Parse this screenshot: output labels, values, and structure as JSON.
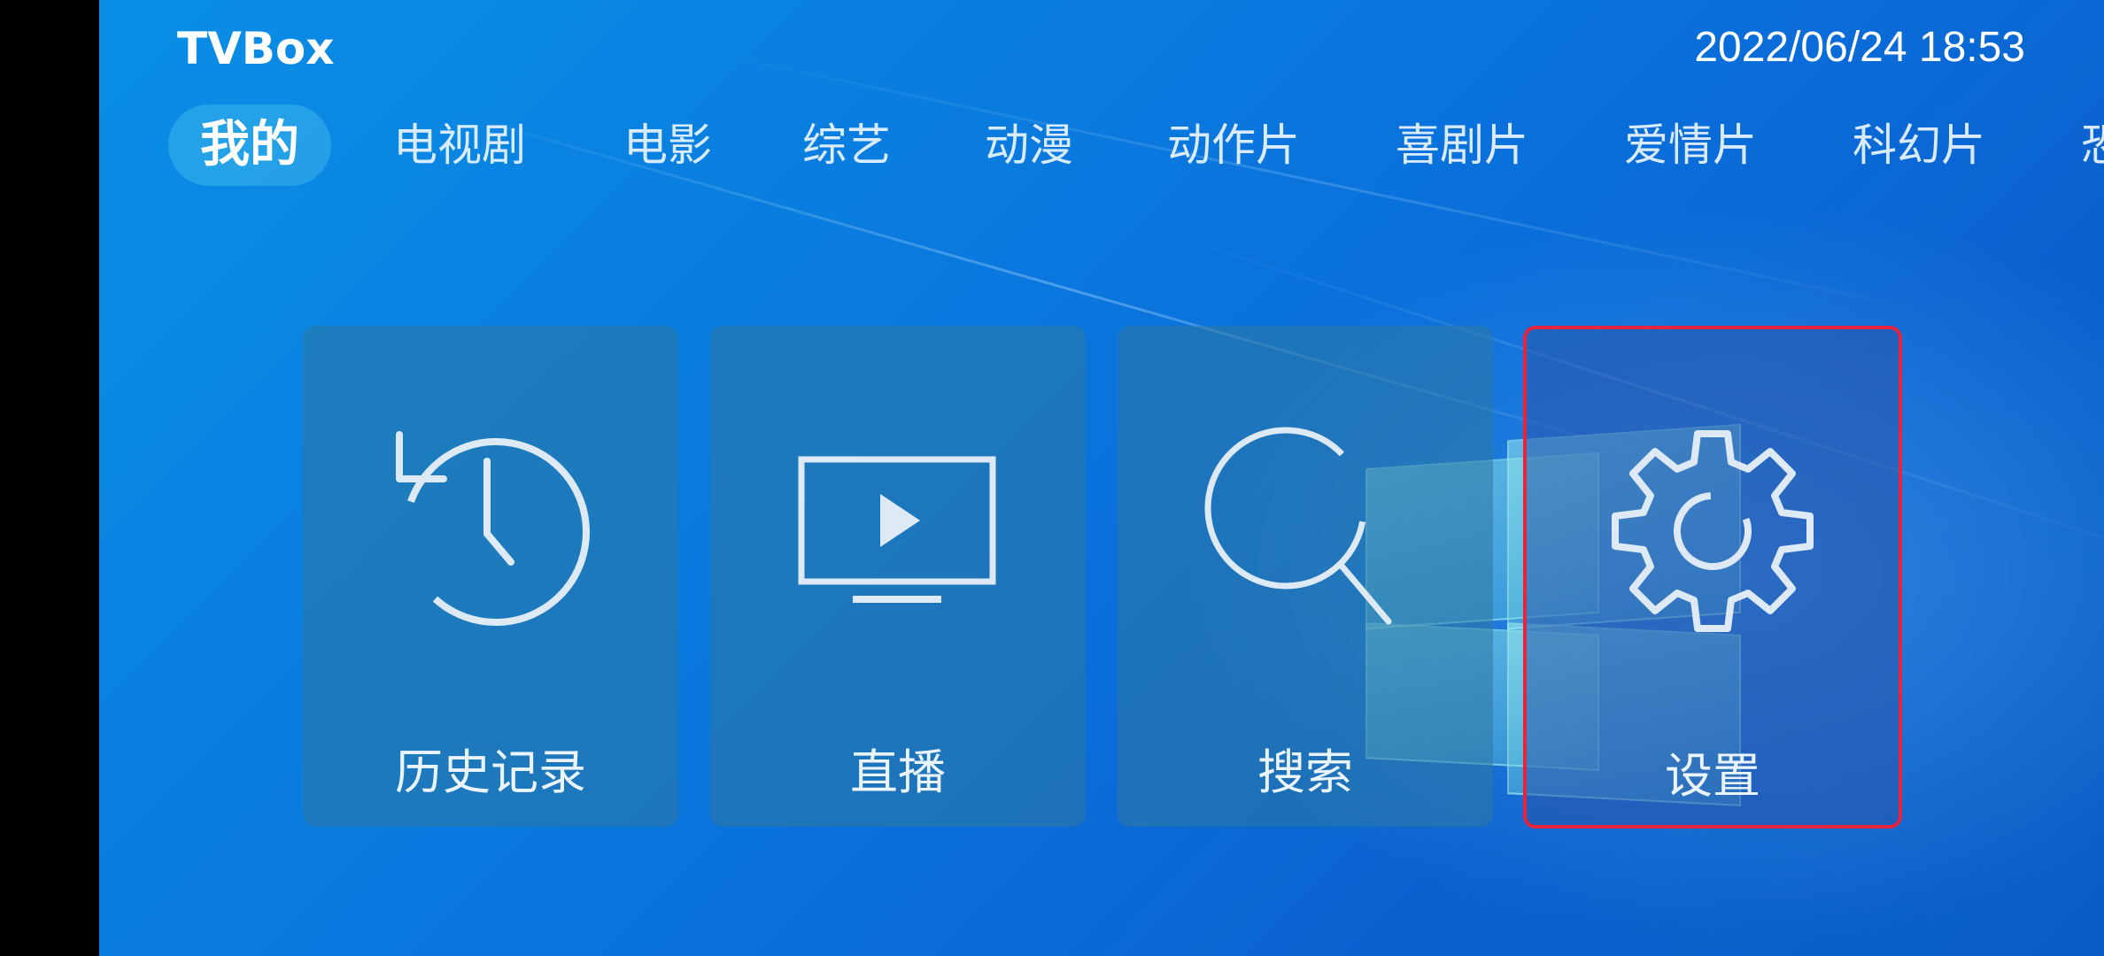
{
  "header": {
    "app_title": "TVBox",
    "datetime": "2022/06/24 18:53"
  },
  "tabs": [
    {
      "label": "我的",
      "active": true
    },
    {
      "label": "电视剧",
      "active": false
    },
    {
      "label": "电影",
      "active": false
    },
    {
      "label": "综艺",
      "active": false
    },
    {
      "label": "动漫",
      "active": false
    },
    {
      "label": "动作片",
      "active": false
    },
    {
      "label": "喜剧片",
      "active": false
    },
    {
      "label": "爱情片",
      "active": false
    },
    {
      "label": "科幻片",
      "active": false
    },
    {
      "label": "恐",
      "active": false
    }
  ],
  "cards": [
    {
      "label": "历史记录",
      "icon": "history-icon"
    },
    {
      "label": "直播",
      "icon": "live-tv-icon"
    },
    {
      "label": "搜索",
      "icon": "search-icon"
    },
    {
      "label": "设置",
      "icon": "gear-icon",
      "focused": true
    }
  ],
  "colors": {
    "focus_border": "#e8233c",
    "icon_stroke": "#dde9f4"
  }
}
